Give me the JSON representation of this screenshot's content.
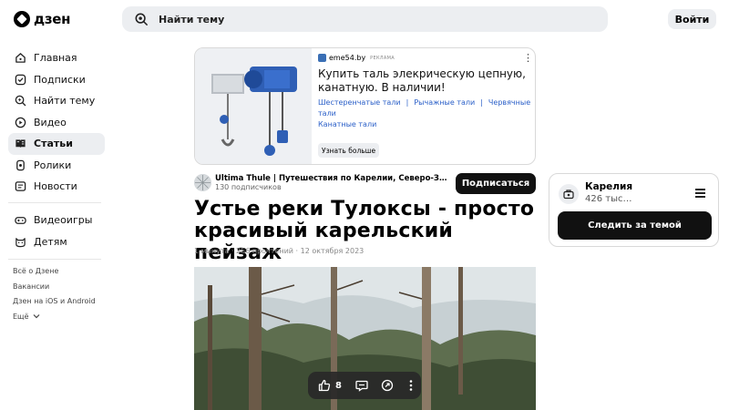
{
  "header": {
    "logo_text": "дзен",
    "search_placeholder": "Найти тему",
    "login_label": "Войти"
  },
  "sidebar": {
    "items": [
      {
        "label": "Главная",
        "icon": "home-icon",
        "active": false
      },
      {
        "label": "Подписки",
        "icon": "subscriptions-icon",
        "active": false
      },
      {
        "label": "Найти тему",
        "icon": "find-topic-icon",
        "active": false
      },
      {
        "label": "Видео",
        "icon": "video-icon",
        "active": false
      },
      {
        "label": "Статьи",
        "icon": "articles-icon",
        "active": true
      },
      {
        "label": "Ролики",
        "icon": "shorts-icon",
        "active": false
      },
      {
        "label": "Новости",
        "icon": "news-icon",
        "active": false
      }
    ],
    "extra_items": [
      {
        "label": "Видеоигры",
        "icon": "gamepad-icon"
      },
      {
        "label": "Детям",
        "icon": "kids-icon"
      }
    ],
    "footer_links": [
      "Всё о Дзене",
      "Вакансии",
      "Дзен на iOS и Android",
      "Ещё"
    ]
  },
  "ad": {
    "domain": "eme54.by",
    "tag": "РЕКЛАМА",
    "title": "Купить таль элекрическую цепную, канатную. В наличии!",
    "links": [
      "Шестеренчатые тали",
      "Рычажные тали",
      "Червячные тали",
      "Канатные тали"
    ],
    "button_label": "Узнать больше"
  },
  "channel": {
    "name": "Ultima Thule | Путешествия по Карелии, Северо-Западу России",
    "subscribers": "130 подписчиков",
    "subscribe_label": "Подписаться"
  },
  "article": {
    "title": "Устье реки Тулоксы - просто красивый карельский пейзаж",
    "meta": "1 минута · 256 прочтений · 12 октября 2023"
  },
  "actions": {
    "likes": "8"
  },
  "topic": {
    "name": "Карелия",
    "count": "426 тыс…",
    "follow_label": "Следить за темой"
  },
  "colors": {
    "accent_dark": "#111111",
    "surface_gray": "#eceef1",
    "link_blue": "#2a5fc8"
  }
}
